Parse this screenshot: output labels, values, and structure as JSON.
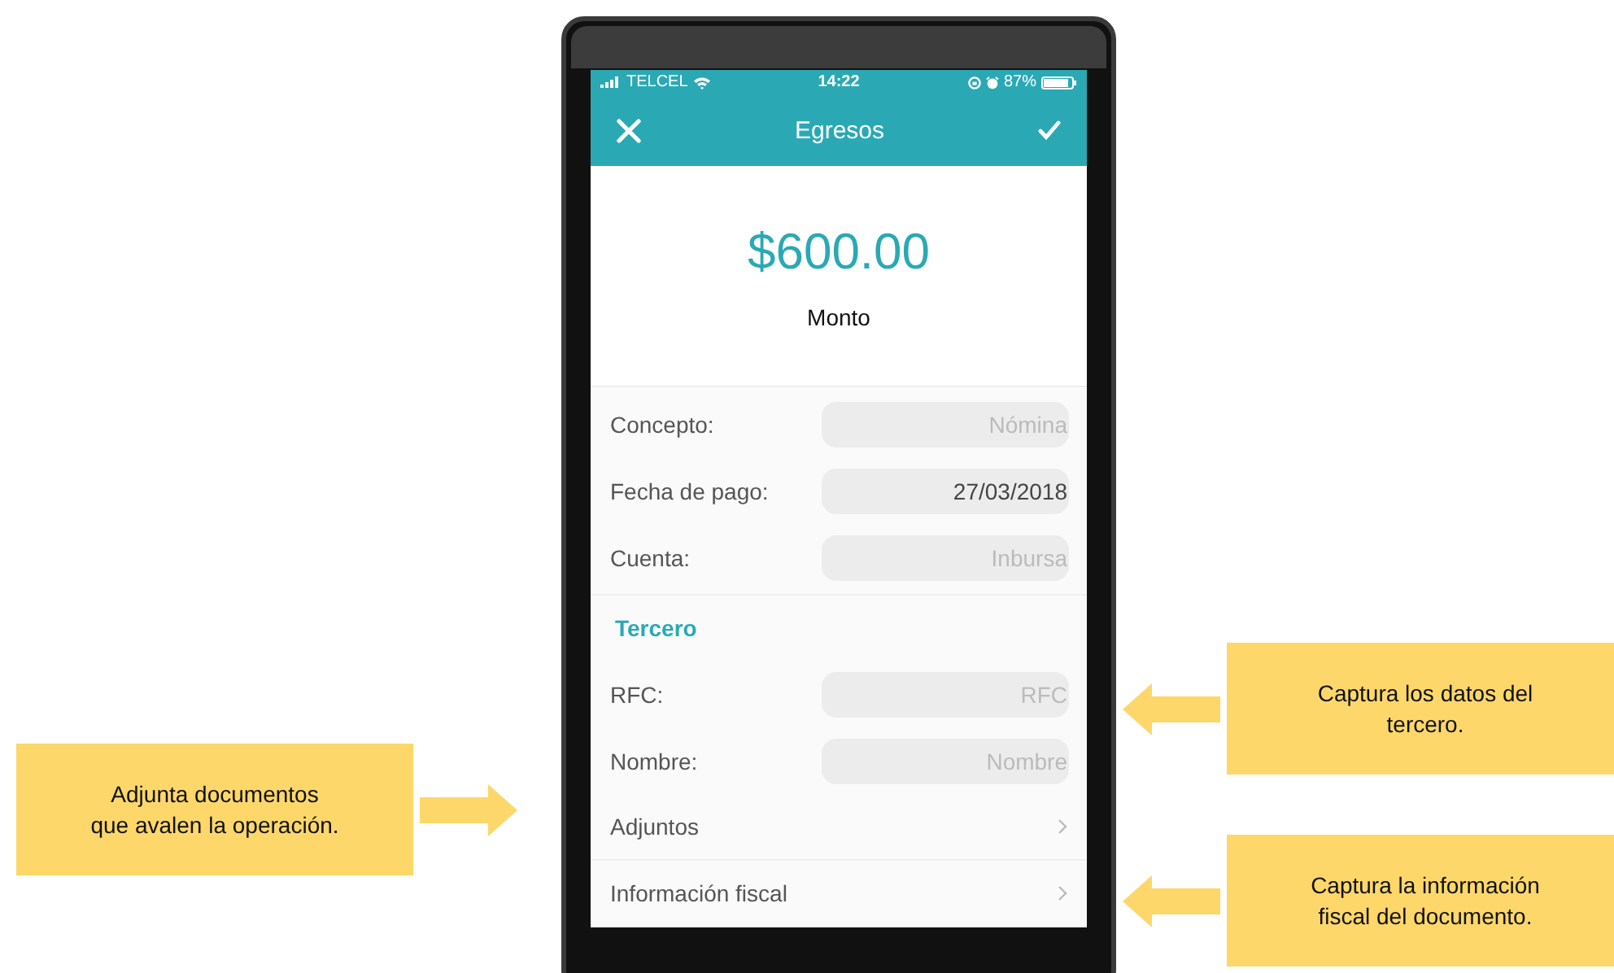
{
  "status_bar": {
    "carrier": "TELCEL",
    "time": "14:22",
    "battery": "87%"
  },
  "nav": {
    "title": "Egresos"
  },
  "amount": {
    "value": "$600.00",
    "label": "Monto"
  },
  "fields": [
    {
      "label": "Concepto:",
      "placeholder": "Nómina"
    },
    {
      "label": "Fecha de pago:",
      "value": "27/03/2018"
    },
    {
      "label": "Cuenta:",
      "placeholder": "Inbursa"
    }
  ],
  "section": {
    "title": "Tercero"
  },
  "third_party_fields": [
    {
      "label": "RFC:",
      "placeholder": "RFC"
    },
    {
      "label": "Nombre:",
      "placeholder": "Nombre"
    }
  ],
  "links": [
    {
      "label": "Adjuntos"
    },
    {
      "label": "Información fiscal"
    }
  ],
  "callouts": [
    {
      "text": "Adjunta documentos\nque avalen la operación.",
      "kind": "left"
    },
    {
      "text": "Captura los datos del\ntercero.",
      "kind": "right"
    },
    {
      "text": "Captura la información\nfiscal del documento.",
      "kind": "right"
    }
  ]
}
